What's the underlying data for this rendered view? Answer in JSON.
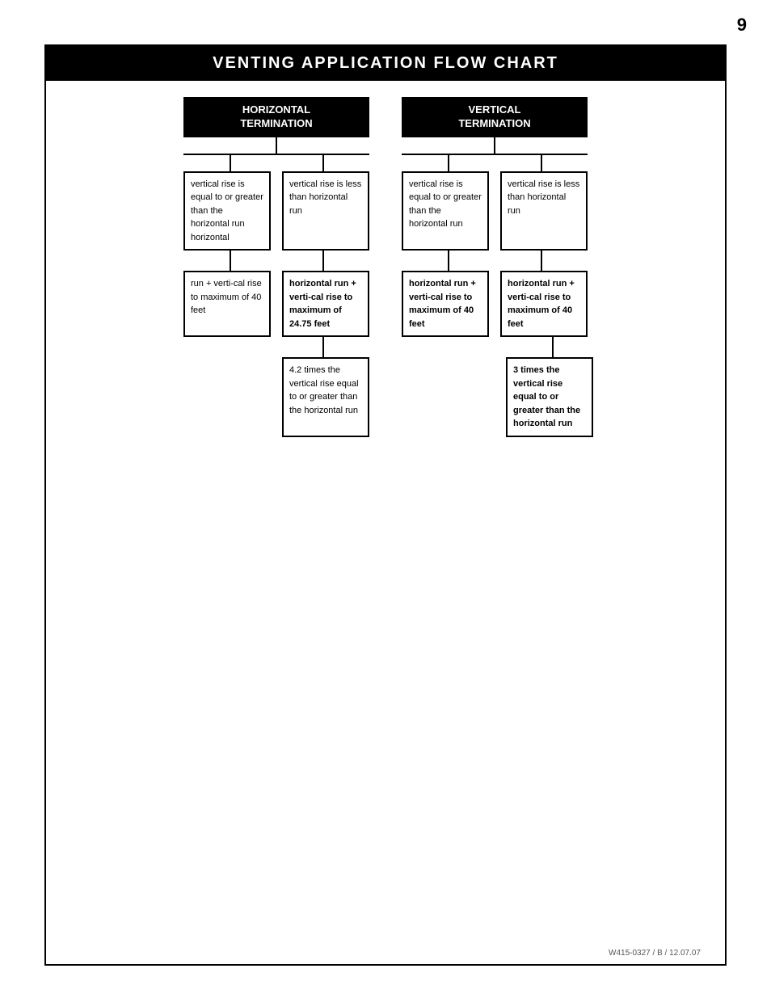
{
  "page": {
    "number": "9",
    "title": "VENTING APPLICATION FLOW CHART",
    "footer": "W415-0327 / B / 12.07.07"
  },
  "sections": {
    "horizontal": {
      "label": "HORIZONTAL\nTERMINATION",
      "sub1": {
        "level1": "vertical rise is equal to or greater than the horizontal run horizontal",
        "level2": "run + verti-cal rise to maximum of 40 feet"
      },
      "sub2": {
        "level1": "vertical rise is less than horizontal run",
        "level2": "horizontal run + verti-cal rise to maximum of 24.75 feet",
        "level3": "4.2 times the vertical rise equal to or greater than the horizontal run"
      }
    },
    "vertical": {
      "label": "VERTICAL\nTERMINATION",
      "sub1": {
        "level1": "vertical rise is equal to or greater than the horizontal run",
        "level2": "horizontal run + verti-cal rise to maximum of 40 feet"
      },
      "sub2": {
        "level1": "vertical rise is less than horizontal run",
        "level2": "horizontal run + verti-cal rise to maximum of 40 feet",
        "level3": "3 times the vertical rise equal to or greater than the horizontal run"
      }
    }
  }
}
